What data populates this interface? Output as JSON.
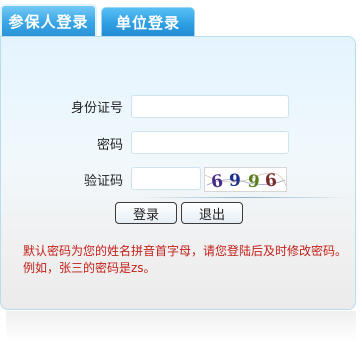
{
  "tabs": [
    {
      "label": "参保人登录"
    },
    {
      "label": "单位登录"
    }
  ],
  "form": {
    "id_label": "身份证号",
    "id_value": "",
    "password_label": "密码",
    "password_value": "",
    "captcha_label": "验证码",
    "captcha_value": "",
    "captcha_text": [
      "6",
      "9",
      "9",
      "6"
    ]
  },
  "buttons": {
    "login": "登录",
    "exit": "退出"
  },
  "note": {
    "line1": "默认密码为您的姓名拼音首字母，请您登陆后及时修改密码。",
    "line2": "例如，张三的密码是zs。"
  },
  "colors": {
    "tab_blue": "#3aa6e6",
    "note_red": "#c3201a"
  }
}
